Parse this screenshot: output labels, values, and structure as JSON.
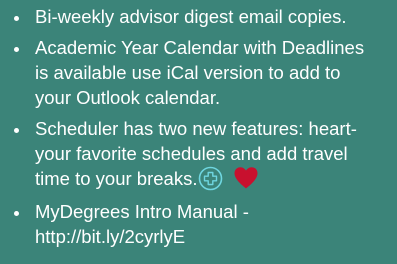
{
  "bullets": [
    {
      "lines": [
        "Bi-weekly advisor digest email copies."
      ]
    },
    {
      "lines": [
        "Academic Year Calendar with Deadlines",
        "is available use iCal version to add to",
        "your Outlook calendar."
      ]
    },
    {
      "lines": [
        "Scheduler has two new features: heart-",
        "your favorite schedules and add travel",
        "time to your breaks."
      ],
      "icons": [
        "plus-circle-icon",
        "heart-icon"
      ]
    },
    {
      "lines": [
        "MyDegrees Intro Manual -",
        " http://bit.ly/2cyrlyE"
      ]
    }
  ],
  "colors": {
    "background": "#3b8479",
    "text": "#ffffff",
    "heart": "#c8102e",
    "plus_circle": "#6fd6e0"
  }
}
